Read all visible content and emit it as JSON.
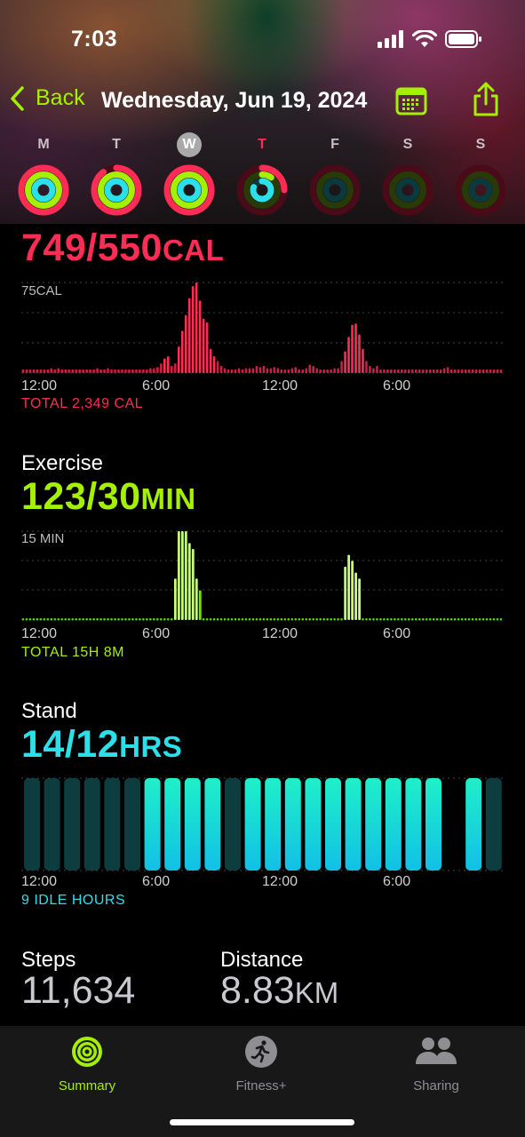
{
  "status": {
    "time": "7:03"
  },
  "nav": {
    "back_label": "Back",
    "title": "Wednesday, Jun 19, 2024"
  },
  "week": {
    "days": [
      {
        "letter": "M"
      },
      {
        "letter": "T"
      },
      {
        "letter": "W"
      },
      {
        "letter": "T"
      },
      {
        "letter": "F"
      },
      {
        "letter": "S"
      },
      {
        "letter": "S"
      }
    ],
    "selected_index": 2,
    "today_index": 3
  },
  "move": {
    "value": "749/550",
    "unit": "CAL",
    "y_label": "75CAL",
    "x_ticks": [
      "12:00",
      "6:00",
      "12:00",
      "6:00"
    ],
    "total": "TOTAL 2,349 CAL",
    "color": "#ff2d55"
  },
  "exercise": {
    "title": "Exercise",
    "value": "123/30",
    "unit": "MIN",
    "y_label": "15 MIN",
    "x_ticks": [
      "12:00",
      "6:00",
      "12:00",
      "6:00"
    ],
    "total": "TOTAL 15H 8M",
    "color": "#a4f000"
  },
  "stand": {
    "title": "Stand",
    "value": "14/12",
    "unit": "HRS",
    "x_ticks": [
      "12:00",
      "6:00",
      "12:00",
      "6:00"
    ],
    "total": "9 IDLE HOURS",
    "color": "#2be0e8"
  },
  "steps": {
    "label": "Steps",
    "value": "11,634"
  },
  "distance": {
    "label": "Distance",
    "value": "8.83",
    "unit": "KM"
  },
  "tabs": [
    {
      "label": "Summary",
      "active": true
    },
    {
      "label": "Fitness+",
      "active": false
    },
    {
      "label": "Sharing",
      "active": false
    }
  ],
  "chart_data": [
    {
      "type": "bar",
      "title": "Move",
      "y_unit": "CAL",
      "ylim": [
        0,
        75
      ],
      "x_range": [
        "12:00 AM",
        "12:00 AM"
      ],
      "interval_minutes": 15,
      "values": [
        3,
        3,
        3,
        3,
        3,
        3,
        3,
        3,
        4,
        3,
        4,
        3,
        3,
        3,
        3,
        3,
        3,
        3,
        3,
        3,
        3,
        4,
        3,
        3,
        4,
        3,
        3,
        3,
        3,
        3,
        3,
        3,
        3,
        3,
        3,
        3,
        4,
        4,
        5,
        8,
        12,
        14,
        6,
        8,
        22,
        35,
        48,
        62,
        72,
        75,
        60,
        45,
        42,
        20,
        14,
        10,
        6,
        4,
        3,
        3,
        3,
        4,
        3,
        4,
        4,
        4,
        6,
        5,
        6,
        4,
        4,
        5,
        4,
        3,
        3,
        3,
        4,
        5,
        3,
        3,
        4,
        7,
        6,
        4,
        3,
        3,
        3,
        3,
        4,
        4,
        10,
        18,
        30,
        40,
        41,
        32,
        20,
        10,
        6,
        4,
        6,
        3,
        3,
        3,
        3,
        3,
        3,
        3,
        3,
        3,
        3,
        3,
        3,
        3,
        3,
        3,
        3,
        3,
        3,
        4,
        5,
        3,
        3,
        3,
        3,
        3,
        3,
        3,
        3,
        3,
        3,
        3,
        3,
        3,
        3,
        3
      ]
    },
    {
      "type": "bar",
      "title": "Exercise",
      "y_unit": "MIN",
      "ylim": [
        0,
        15
      ],
      "x_range": [
        "12:00 AM",
        "12:00 AM"
      ],
      "interval_minutes": 15,
      "values": [
        0,
        0,
        0,
        0,
        0,
        0,
        0,
        0,
        0,
        0,
        0,
        0,
        0,
        0,
        0,
        0,
        0,
        0,
        0,
        0,
        0,
        0,
        0,
        0,
        0,
        0,
        0,
        0,
        0,
        0,
        0,
        0,
        0,
        0,
        0,
        0,
        0,
        0,
        0,
        0,
        0,
        0,
        0,
        0,
        0,
        0,
        0,
        0,
        0,
        0,
        0,
        0,
        0,
        0,
        0,
        0,
        0,
        0,
        0,
        0,
        0,
        0,
        0,
        0,
        0,
        0,
        0,
        0,
        0,
        0,
        0,
        0,
        0,
        0,
        0,
        0,
        0,
        0,
        0,
        0,
        0,
        0,
        0,
        0,
        0,
        0,
        0,
        0,
        0,
        0,
        0,
        0,
        0,
        0,
        0,
        0,
        0,
        0,
        0,
        0,
        0,
        0,
        0,
        0,
        0,
        0,
        0,
        0,
        0,
        0,
        0,
        0,
        0,
        0,
        0,
        0,
        0,
        0,
        0,
        0,
        0,
        0,
        0,
        0,
        0,
        0,
        0,
        0,
        0,
        0,
        0,
        0,
        0,
        0,
        0,
        0
      ]
    },
    {
      "type": "bar",
      "title": "Stand",
      "y_unit": "HRS",
      "categories": [
        "0",
        "1",
        "2",
        "3",
        "4",
        "5",
        "6",
        "7",
        "8",
        "9",
        "10",
        "11",
        "12",
        "13",
        "14",
        "15",
        "16",
        "17",
        "18",
        "19",
        "20",
        "21",
        "22",
        "23"
      ],
      "stood": [
        0,
        0,
        0,
        0,
        0,
        0,
        1,
        1,
        1,
        1,
        0,
        1,
        1,
        1,
        1,
        1,
        1,
        1,
        1,
        1,
        1,
        0,
        1,
        0
      ]
    }
  ]
}
